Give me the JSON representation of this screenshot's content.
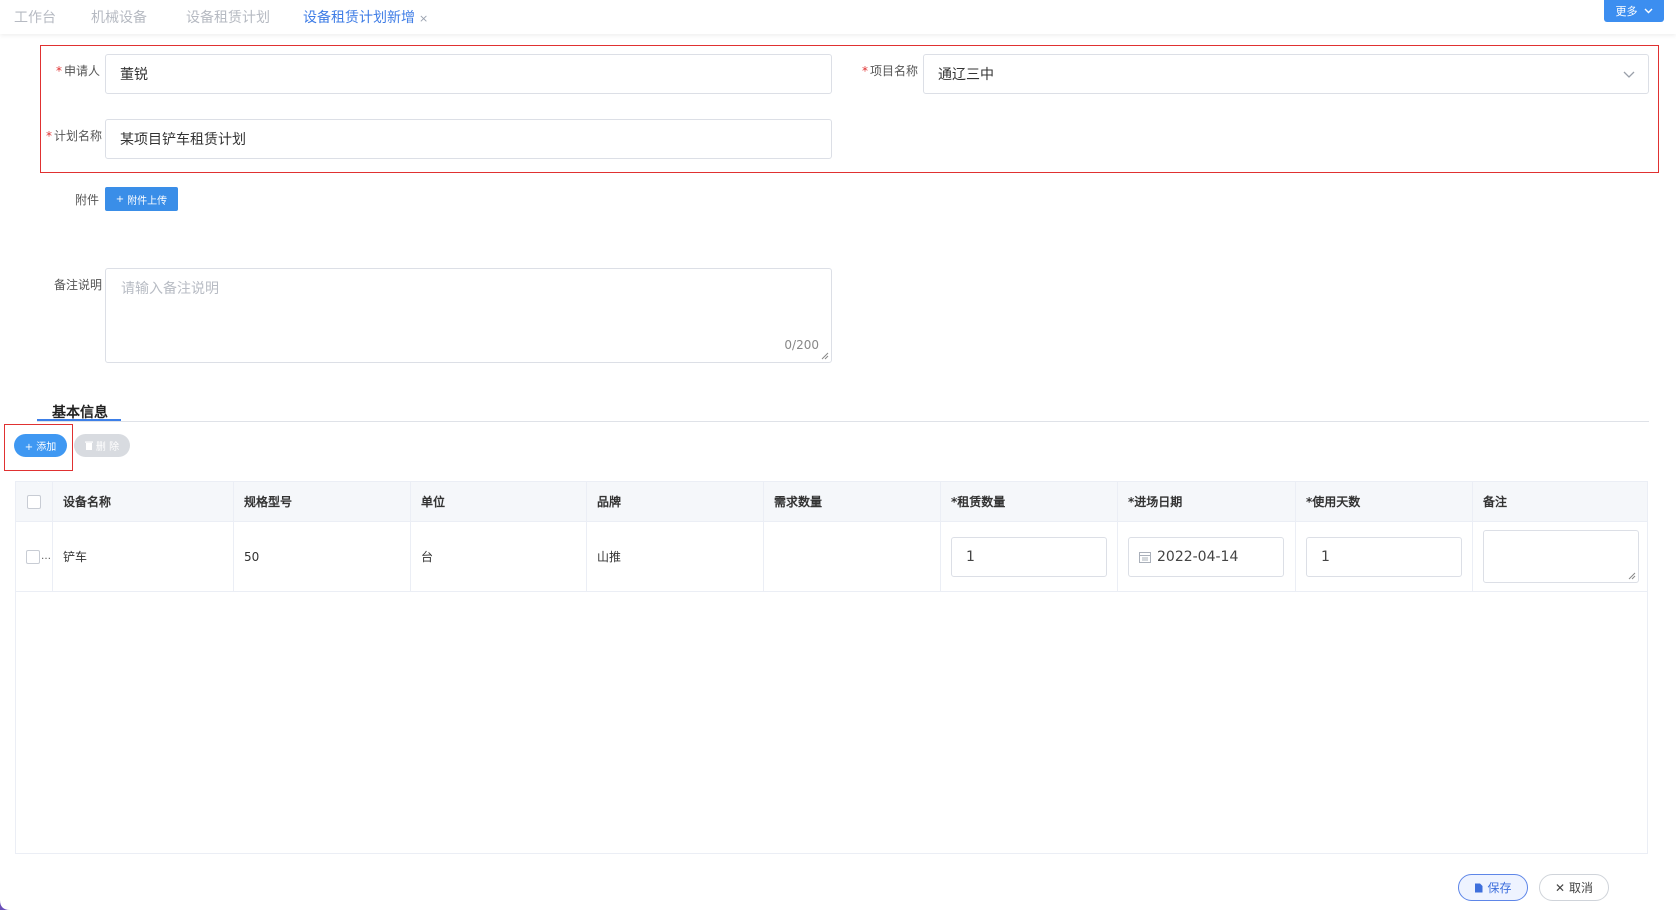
{
  "tabs": [
    {
      "label": "工作台"
    },
    {
      "label": "机械设备"
    },
    {
      "label": "设备租赁计划"
    },
    {
      "label": "设备租赁计划新增",
      "close": "×"
    }
  ],
  "header": {
    "more_label": "更多"
  },
  "form": {
    "applicant_label": "申请人",
    "applicant_value": "董锐",
    "project_label": "项目名称",
    "project_value": "通辽三中",
    "plan_label": "计划名称",
    "plan_value": "某项目铲车租赁计划",
    "required_mark": "*",
    "attachment_label": "附件",
    "upload_label": "附件上传",
    "remark_label": "备注说明",
    "remark_placeholder": "请输入备注说明",
    "remark_count": "0/200"
  },
  "section": {
    "title": "基本信息"
  },
  "toolbar": {
    "add_label": "+ 添加",
    "delete_label": "删 除"
  },
  "table": {
    "columns": [
      "设备名称",
      "规格型号",
      "单位",
      "品牌",
      "需求数量",
      "*租赁数量",
      "*进场日期",
      "*使用天数",
      "备注"
    ],
    "rows": [
      {
        "name": "铲车",
        "spec": "50",
        "unit": "台",
        "brand": "山推",
        "demand": "",
        "rent_qty": "1",
        "entry_date": "2022-04-14",
        "days": "1",
        "remark": ""
      }
    ]
  },
  "footer": {
    "save_label": "保存",
    "cancel_label": "取消"
  },
  "colors": {
    "accent": "#3f7de6",
    "danger": "#e03131",
    "primary_btn": "#3a8ee8"
  }
}
